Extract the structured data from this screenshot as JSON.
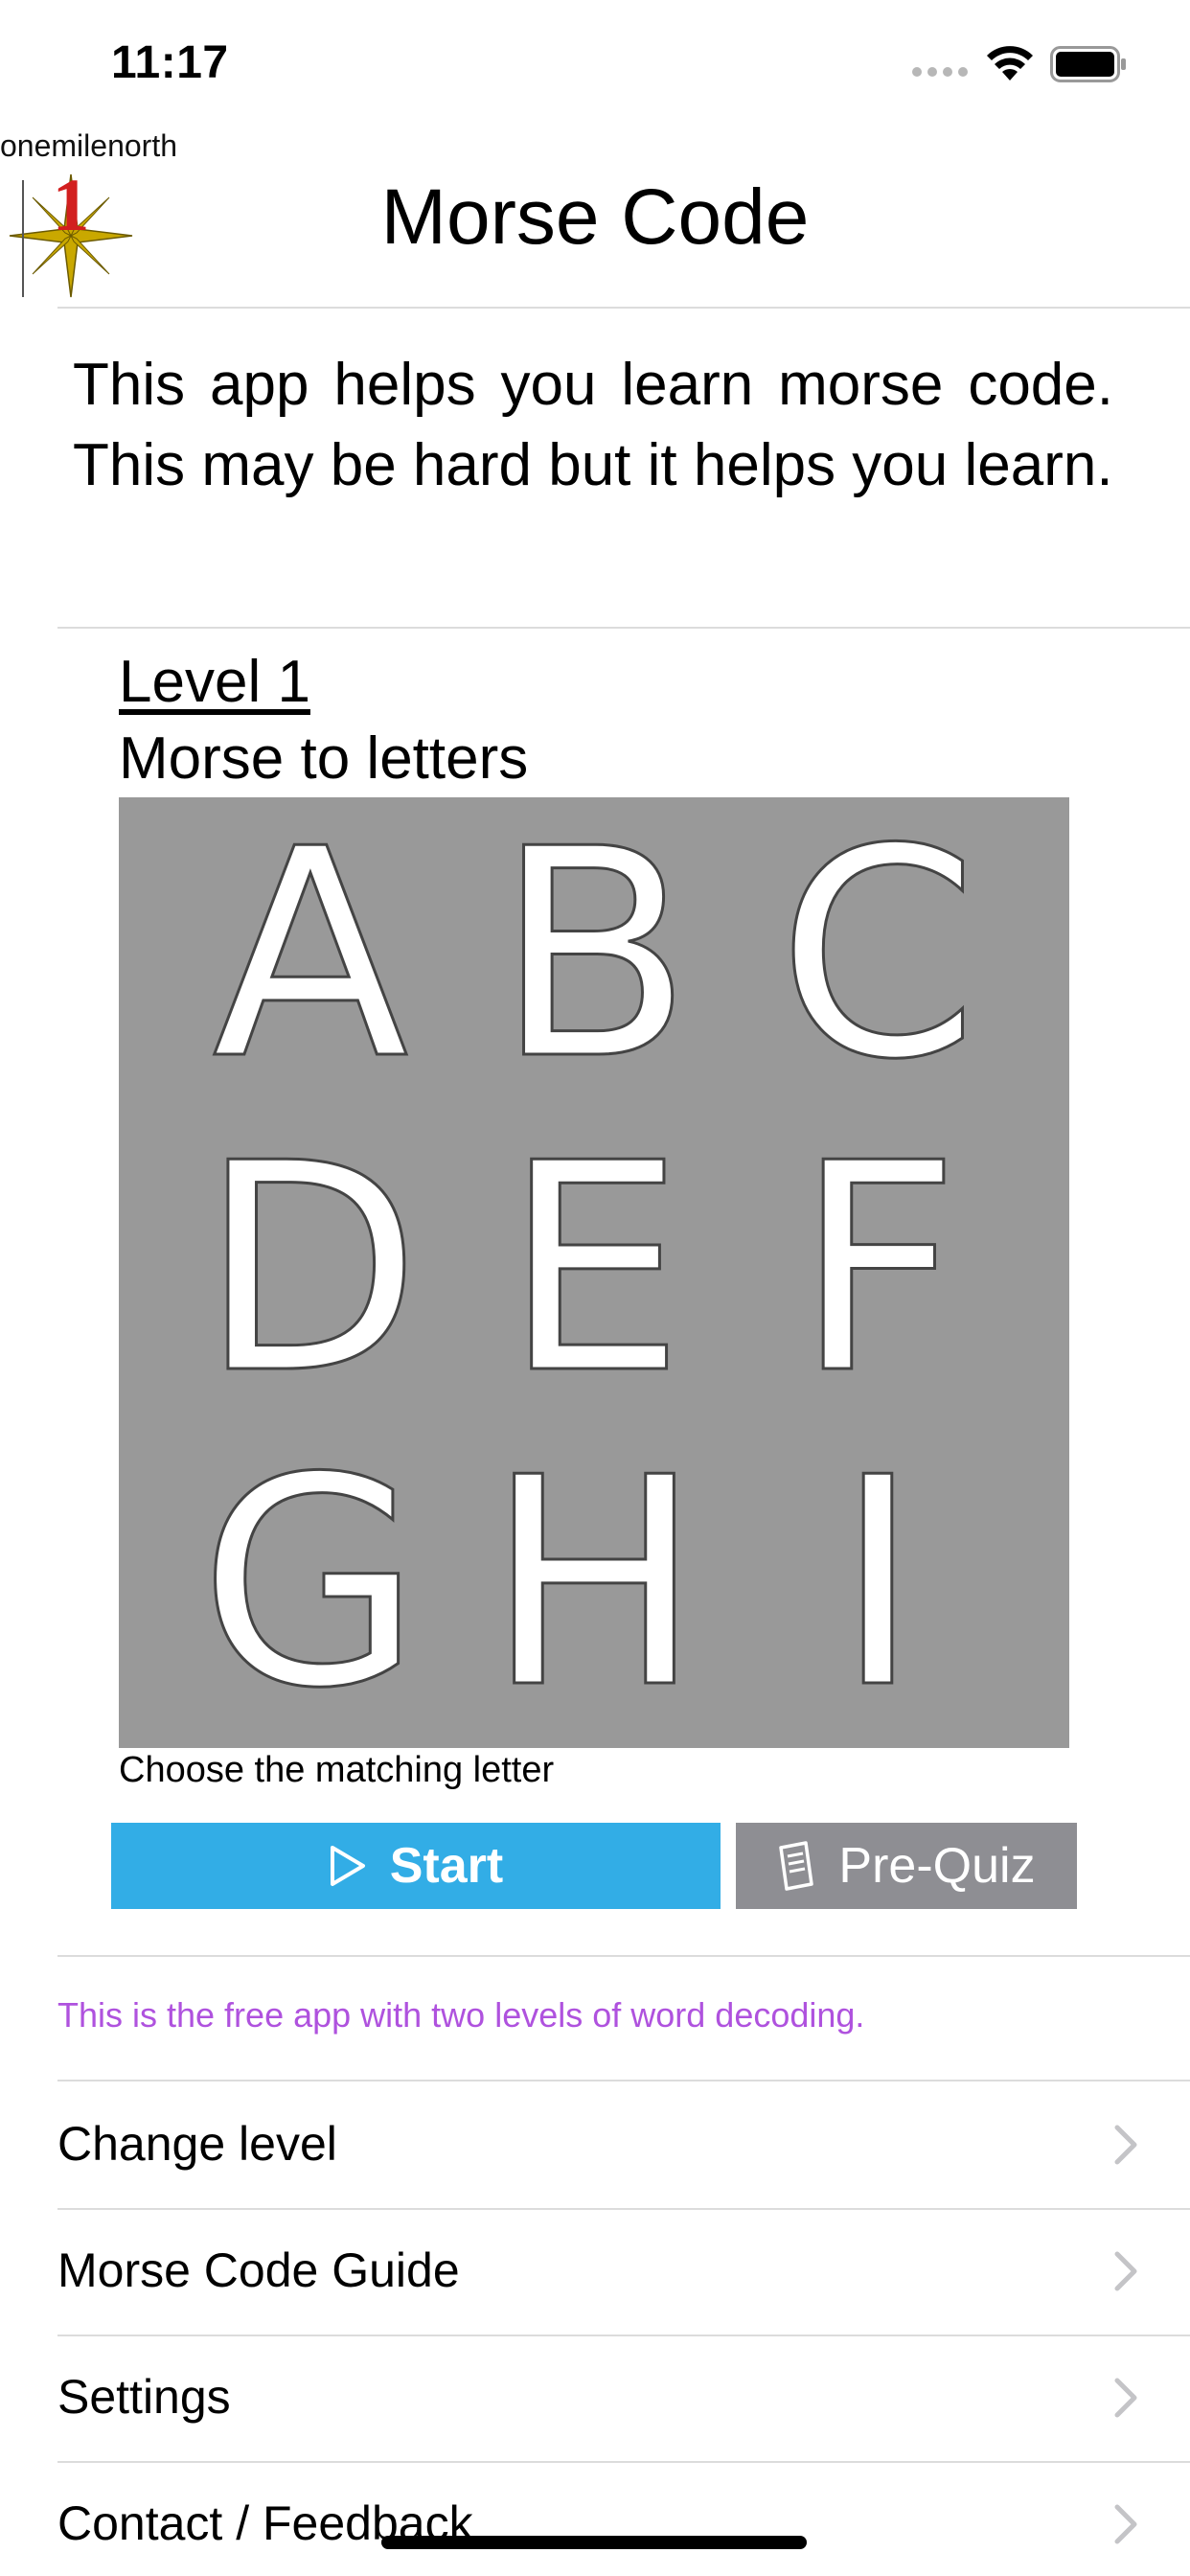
{
  "status_bar": {
    "time": "11:17"
  },
  "header": {
    "brand": "onemilenorth",
    "logo_digit": "1",
    "title": "Morse Code"
  },
  "intro": {
    "text": "This app helps you learn morse code. This may be hard but it helps you learn."
  },
  "level": {
    "title": "Level 1",
    "subtitle": "Morse to letters",
    "letters": [
      "A",
      "B",
      "C",
      "D",
      "E",
      "F",
      "G",
      "H",
      "I"
    ],
    "instruction": "Choose the matching letter",
    "grid_color": "#999999"
  },
  "buttons": {
    "start_label": "Start",
    "start_icon": "play-icon",
    "start_color": "#32ade6",
    "prequiz_label": "Pre-Quiz",
    "prequiz_icon": "document-icon",
    "prequiz_color": "#8e8e93"
  },
  "note": {
    "text": "This is the free app with two levels of word decoding.",
    "color": "#af52de"
  },
  "menu": {
    "items": [
      {
        "label": "Change level"
      },
      {
        "label": "Morse Code Guide"
      },
      {
        "label": "Settings"
      },
      {
        "label": "Contact / Feedback"
      }
    ]
  }
}
